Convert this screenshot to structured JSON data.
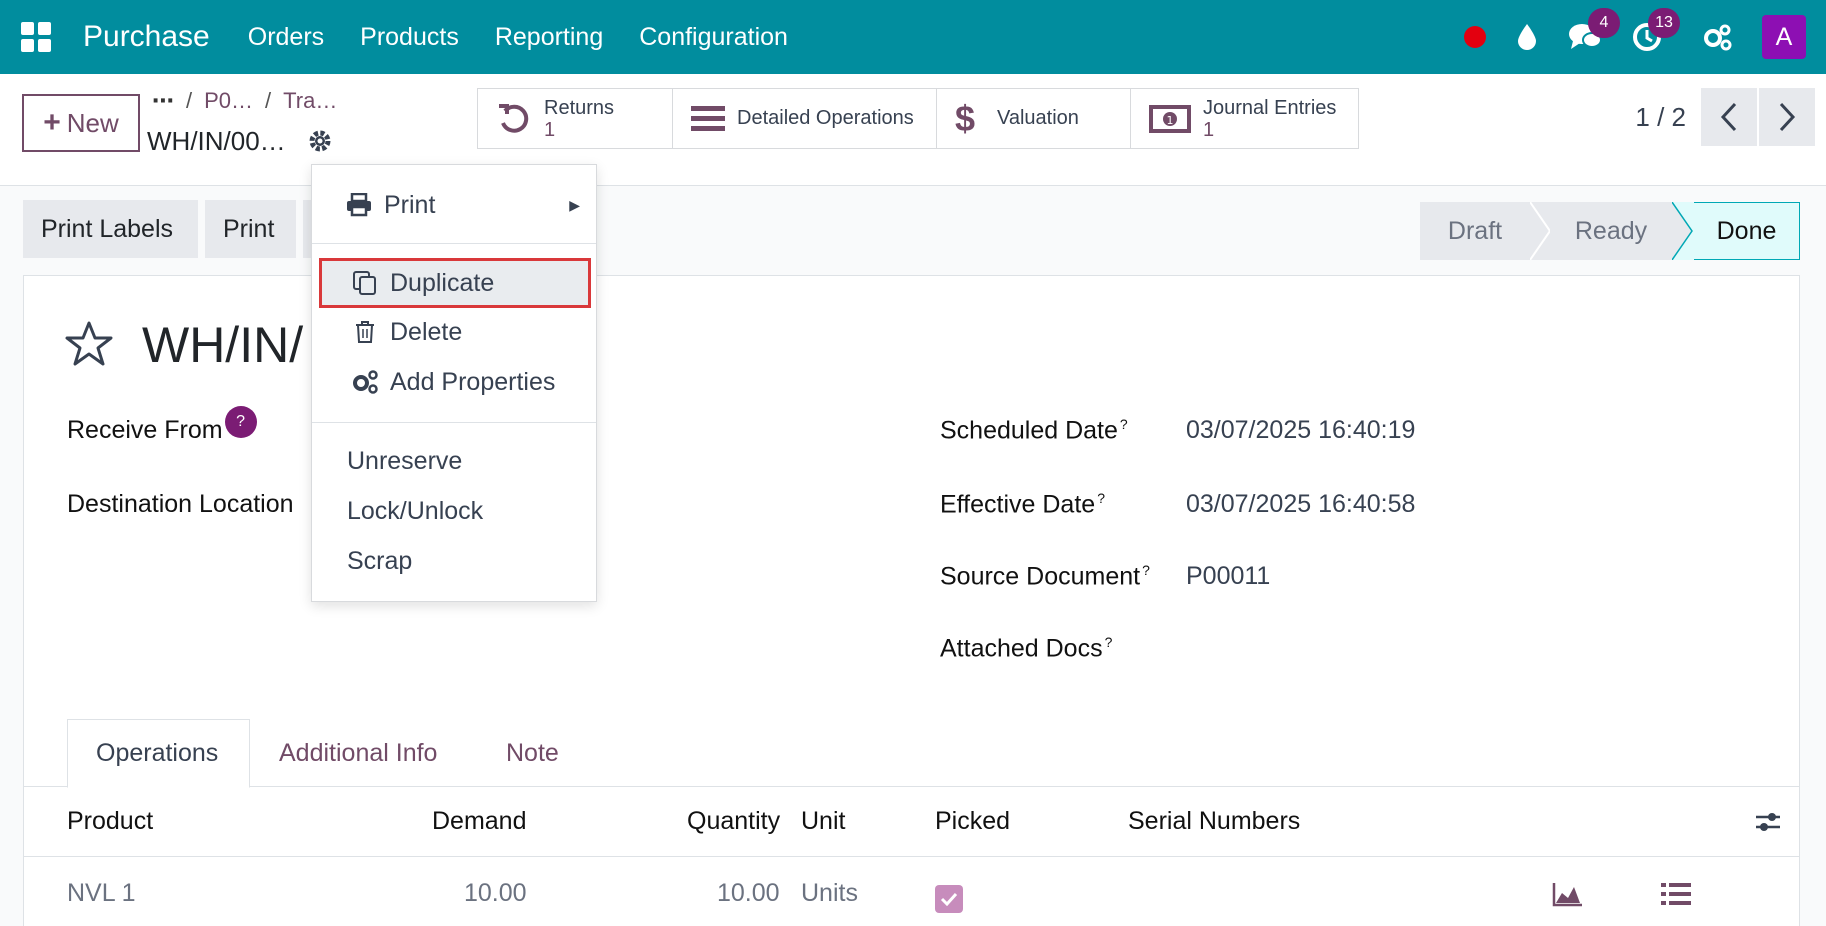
{
  "navbar": {
    "brand": "Purchase",
    "menus": [
      "Orders",
      "Products",
      "Reporting",
      "Configuration"
    ],
    "messages_badge": "4",
    "activities_badge": "13",
    "avatar_letter": "A"
  },
  "control_panel": {
    "new_label": "New",
    "breadcrumb": [
      "P0…",
      "Tra…"
    ],
    "record_name": "WH/IN/00…",
    "smart_buttons": [
      {
        "label": "Returns",
        "count": "1"
      },
      {
        "label": "Detailed Operations",
        "count": ""
      },
      {
        "label": "Valuation",
        "count": ""
      },
      {
        "label": "Journal Entries",
        "count": "1"
      }
    ],
    "pager": "1 / 2"
  },
  "actions": {
    "print_labels": "Print Labels",
    "print": "Print"
  },
  "statusbar": {
    "stages": [
      "Draft",
      "Ready",
      "Done"
    ],
    "current": "Done"
  },
  "form": {
    "title": "WH/IN/",
    "fields": {
      "receive_from": "Receive From",
      "destination_location": "Destination Location",
      "scheduled_date_label": "Scheduled Date",
      "scheduled_date": "03/07/2025 16:40:19",
      "effective_date_label": "Effective Date",
      "effective_date": "03/07/2025 16:40:58",
      "source_document_label": "Source Document",
      "source_document": "P00011",
      "attached_docs_label": "Attached Docs"
    },
    "tabs": [
      "Operations",
      "Additional Info",
      "Note"
    ],
    "table": {
      "headers": [
        "Product",
        "Demand",
        "Quantity",
        "Unit",
        "Picked",
        "Serial Numbers"
      ],
      "rows": [
        {
          "product": "NVL 1",
          "demand": "10.00",
          "quantity": "10.00",
          "unit": "Units",
          "picked": true
        }
      ]
    }
  },
  "dropdown": {
    "print": "Print",
    "duplicate": "Duplicate",
    "delete": "Delete",
    "add_properties": "Add Properties",
    "unreserve": "Unreserve",
    "lock_unlock": "Lock/Unlock",
    "scrap": "Scrap"
  },
  "colors": {
    "navbar": "#018d9e",
    "primary": "#714b67",
    "badge": "#7b1c74",
    "highlight_border": "#d9383a",
    "done_stage": "#e0fbfb"
  }
}
